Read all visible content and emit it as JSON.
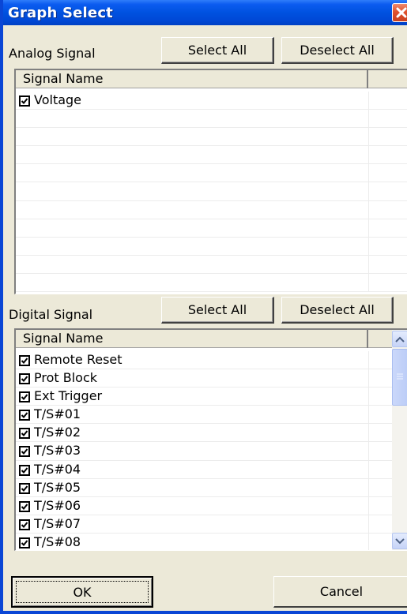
{
  "window": {
    "title": "Graph Select",
    "close_icon": "close-icon"
  },
  "analog": {
    "label": "Analog Signal",
    "select_all": "Select All",
    "deselect_all": "Deselect All",
    "column_header": "Signal Name",
    "items": [
      {
        "label": "Voltage",
        "checked": true
      }
    ]
  },
  "digital": {
    "label": "Digital Signal",
    "select_all": "Select All",
    "deselect_all": "Deselect All",
    "column_header": "Signal Name",
    "items": [
      {
        "label": "Remote Reset",
        "checked": true
      },
      {
        "label": "Prot Block",
        "checked": true
      },
      {
        "label": "Ext Trigger",
        "checked": true
      },
      {
        "label": "T/S#01",
        "checked": true
      },
      {
        "label": "T/S#02",
        "checked": true
      },
      {
        "label": "T/S#03",
        "checked": true
      },
      {
        "label": "T/S#04",
        "checked": true
      },
      {
        "label": "T/S#05",
        "checked": true
      },
      {
        "label": "T/S#06",
        "checked": true
      },
      {
        "label": "T/S#07",
        "checked": true
      },
      {
        "label": "T/S#08",
        "checked": true
      }
    ]
  },
  "footer": {
    "ok_label": "OK",
    "cancel_label": "Cancel"
  },
  "colors": {
    "titlebar": "#0052e0",
    "close_button": "#e0532e",
    "window_face": "#ece9d8"
  }
}
